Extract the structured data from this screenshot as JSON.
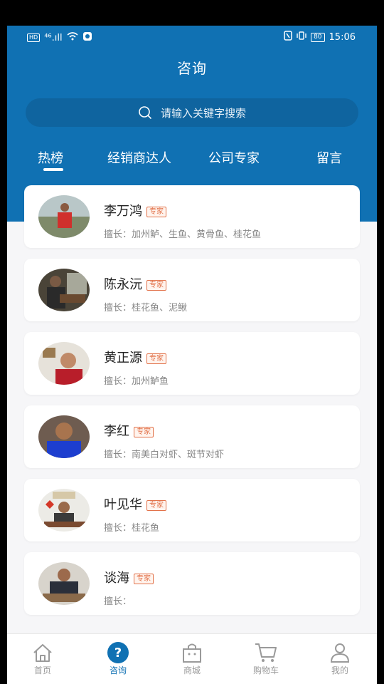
{
  "status_bar": {
    "hd": "HD",
    "signal": "⁴⁶.ıll",
    "battery": "80",
    "time": "15:06"
  },
  "header": {
    "title": "咨询"
  },
  "search": {
    "placeholder": "请输入关键字搜索"
  },
  "tabs": [
    {
      "label": "热榜",
      "active": true
    },
    {
      "label": "经销商达人",
      "active": false
    },
    {
      "label": "公司专家",
      "active": false
    },
    {
      "label": "留言",
      "active": false
    }
  ],
  "experts": [
    {
      "name": "李万鸿",
      "badge": "专家",
      "specialty": "擅长：加州鲈、生鱼、黄骨鱼、桂花鱼"
    },
    {
      "name": "陈永沅",
      "badge": "专家",
      "specialty": "擅长：桂花鱼、泥鳅"
    },
    {
      "name": "黄正源",
      "badge": "专家",
      "specialty": "擅长：加州鲈鱼"
    },
    {
      "name": "李红",
      "badge": "专家",
      "specialty": "擅长：南美白对虾、斑节对虾"
    },
    {
      "name": "叶见华",
      "badge": "专家",
      "specialty": "擅长：桂花鱼"
    },
    {
      "name": "谈海",
      "badge": "专家",
      "specialty": "擅长："
    }
  ],
  "bottom_nav": [
    {
      "label": "首页",
      "icon": "home-icon"
    },
    {
      "label": "咨询",
      "icon": "question-icon",
      "active": true
    },
    {
      "label": "商城",
      "icon": "shop-bag-icon"
    },
    {
      "label": "购物车",
      "icon": "cart-icon"
    },
    {
      "label": "我的",
      "icon": "user-icon"
    }
  ],
  "colors": {
    "primary": "#1071b3",
    "badge": "#e2724a"
  }
}
